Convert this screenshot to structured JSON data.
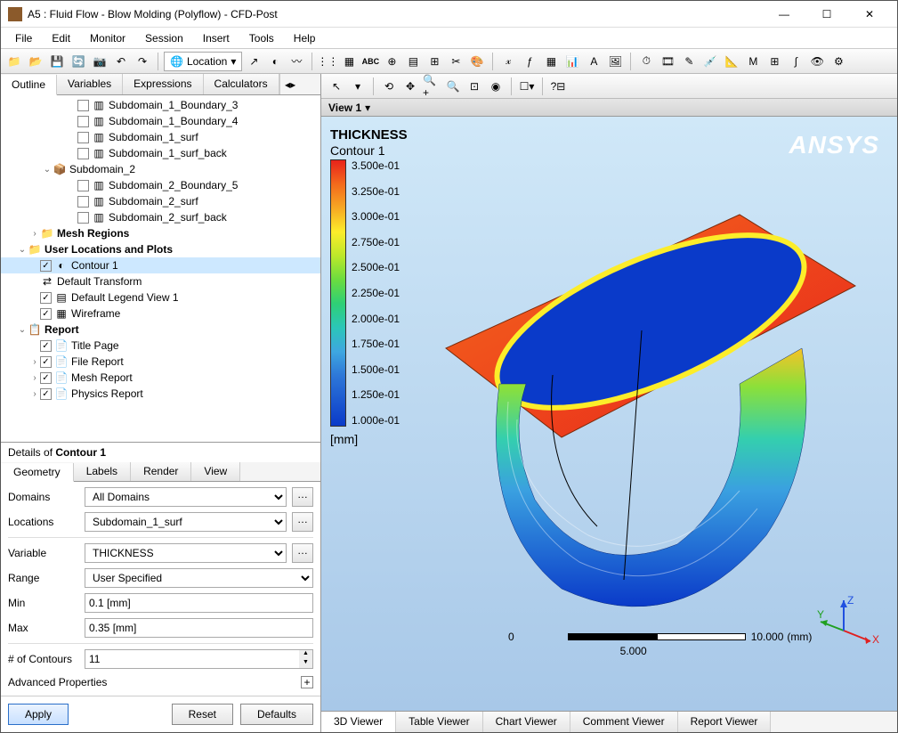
{
  "window": {
    "title": "A5 : Fluid Flow - Blow Molding (Polyflow) - CFD-Post",
    "min": "—",
    "max": "☐",
    "close": "✕"
  },
  "menu": [
    "File",
    "Edit",
    "Monitor",
    "Session",
    "Insert",
    "Tools",
    "Help"
  ],
  "location_combo": "Location",
  "outline_tabs": [
    "Outline",
    "Variables",
    "Expressions",
    "Calculators"
  ],
  "tree": [
    {
      "indent": 5,
      "check": false,
      "label": "Subdomain_1_Boundary_3",
      "icon": "surf"
    },
    {
      "indent": 5,
      "check": false,
      "label": "Subdomain_1_Boundary_4",
      "icon": "surf"
    },
    {
      "indent": 5,
      "check": false,
      "label": "Subdomain_1_surf",
      "icon": "surf"
    },
    {
      "indent": 5,
      "check": false,
      "label": "Subdomain_1_surf_back",
      "icon": "surf"
    },
    {
      "indent": 3,
      "exp": "open",
      "label": "Subdomain_2",
      "icon": "domain"
    },
    {
      "indent": 5,
      "check": false,
      "label": "Subdomain_2_Boundary_5",
      "icon": "surf"
    },
    {
      "indent": 5,
      "check": false,
      "label": "Subdomain_2_surf",
      "icon": "surf"
    },
    {
      "indent": 5,
      "check": false,
      "label": "Subdomain_2_surf_back",
      "icon": "surf"
    },
    {
      "indent": 2,
      "exp": "closed",
      "label": "Mesh Regions",
      "icon": "folder",
      "bold": true
    },
    {
      "indent": 1,
      "exp": "open",
      "label": "User Locations and Plots",
      "icon": "folder",
      "bold": true
    },
    {
      "indent": 2,
      "check": true,
      "label": "Contour 1",
      "icon": "contour",
      "selected": true
    },
    {
      "indent": 2,
      "label": "Default Transform",
      "icon": "transform"
    },
    {
      "indent": 2,
      "check": true,
      "label": "Default Legend View 1",
      "icon": "legend"
    },
    {
      "indent": 2,
      "check": true,
      "label": "Wireframe",
      "icon": "wire"
    },
    {
      "indent": 1,
      "exp": "open",
      "label": "Report",
      "icon": "report",
      "bold": true
    },
    {
      "indent": 2,
      "check": true,
      "label": "Title Page",
      "icon": "page"
    },
    {
      "indent": 2,
      "exp": "closed",
      "check": true,
      "label": "File Report",
      "icon": "page"
    },
    {
      "indent": 2,
      "exp": "closed",
      "check": true,
      "label": "Mesh Report",
      "icon": "page"
    },
    {
      "indent": 2,
      "exp": "closed",
      "check": true,
      "label": "Physics Report",
      "icon": "page"
    }
  ],
  "details": {
    "header_prefix": "Details of ",
    "header_name": "Contour 1",
    "tabs": [
      "Geometry",
      "Labels",
      "Render",
      "View"
    ],
    "rows": {
      "domains_label": "Domains",
      "domains_value": "All Domains",
      "locations_label": "Locations",
      "locations_value": "Subdomain_1_surf",
      "variable_label": "Variable",
      "variable_value": "THICKNESS",
      "range_label": "Range",
      "range_value": "User Specified",
      "min_label": "Min",
      "min_value": "0.1 [mm]",
      "max_label": "Max",
      "max_value": "0.35 [mm]",
      "contours_label": "# of Contours",
      "contours_value": "11",
      "advanced": "Advanced Properties"
    },
    "buttons": {
      "apply": "Apply",
      "reset": "Reset",
      "defaults": "Defaults"
    }
  },
  "view": {
    "view_name": "View 1",
    "legend_title": "THICKNESS",
    "legend_sub": "Contour 1",
    "legend_unit": "[mm]",
    "legend_ticks": [
      "3.500e-01",
      "3.250e-01",
      "3.000e-01",
      "2.750e-01",
      "2.500e-01",
      "2.250e-01",
      "2.000e-01",
      "1.750e-01",
      "1.500e-01",
      "1.250e-01",
      "1.000e-01"
    ],
    "brand": "ANSYS",
    "scale_zero": "0",
    "scale_mid": "5.000",
    "scale_end": "10.000",
    "scale_unit": "(mm)",
    "axes": {
      "x": "X",
      "y": "Y",
      "z": "Z"
    },
    "tabs": [
      "3D Viewer",
      "Table Viewer",
      "Chart Viewer",
      "Comment Viewer",
      "Report Viewer"
    ]
  },
  "chart_data": {
    "type": "contour-legend",
    "title": "THICKNESS",
    "subtitle": "Contour 1",
    "unit": "mm",
    "range": [
      0.1,
      0.35
    ],
    "ticks": [
      0.35,
      0.325,
      0.3,
      0.275,
      0.25,
      0.225,
      0.2,
      0.175,
      0.15,
      0.125,
      0.1
    ],
    "n_contours": 11,
    "colormap": "rainbow"
  }
}
